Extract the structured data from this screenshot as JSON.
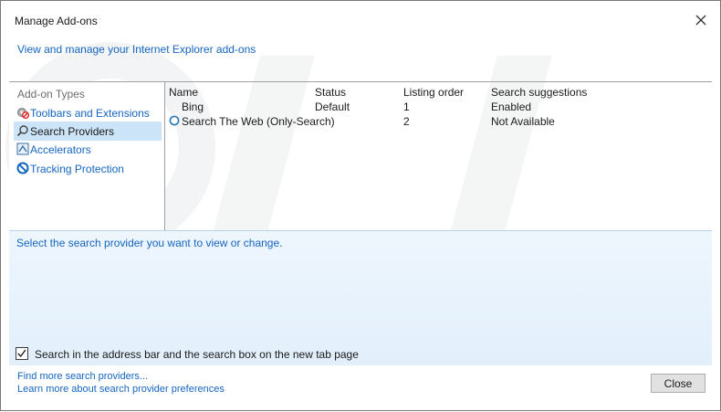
{
  "window": {
    "title": "Manage Add-ons"
  },
  "header": {
    "link": "View and manage your Internet Explorer add-ons"
  },
  "sidebar": {
    "heading": "Add-on Types",
    "items": [
      {
        "label": "Toolbars and Extensions",
        "icon": "gear-blocked-icon",
        "selected": false
      },
      {
        "label": "Search Providers",
        "icon": "magnifier-icon",
        "selected": true
      },
      {
        "label": "Accelerators",
        "icon": "accelerator-icon",
        "selected": false
      },
      {
        "label": "Tracking Protection",
        "icon": "block-icon",
        "selected": false
      }
    ]
  },
  "list": {
    "columns": [
      "Name",
      "Status",
      "Listing order",
      "Search suggestions"
    ],
    "rows": [
      {
        "name": "Bing",
        "status": "Default",
        "order": "1",
        "suggestions": "Enabled",
        "icon": "none"
      },
      {
        "name": "Search The Web (Only-Search)",
        "status": "",
        "order": "2",
        "suggestions": "Not Available",
        "icon": "search-provider-icon"
      }
    ]
  },
  "details": {
    "hint": "Select the search provider you want to view or change.",
    "checkbox_label": "Search in the address bar and the search box on the new tab page",
    "checkbox_checked": true
  },
  "footer": {
    "link1": "Find more search providers...",
    "link2": "Learn more about search provider preferences",
    "close_label": "Close"
  },
  "colors": {
    "link": "#1565c0",
    "selected": "#cce4f7",
    "details_bg": "#e8f2fc"
  }
}
